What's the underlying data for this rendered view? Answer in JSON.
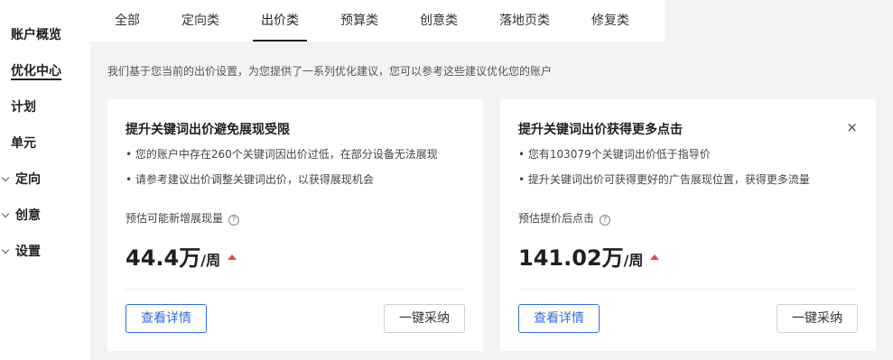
{
  "sidebar": {
    "items": [
      {
        "label": "账户概览"
      },
      {
        "label": "优化中心"
      },
      {
        "label": "计划"
      },
      {
        "label": "单元"
      },
      {
        "label": "定向"
      },
      {
        "label": "创意"
      },
      {
        "label": "设置"
      }
    ]
  },
  "tabs": [
    {
      "label": "全部"
    },
    {
      "label": "定向类"
    },
    {
      "label": "出价类"
    },
    {
      "label": "预算类"
    },
    {
      "label": "创意类"
    },
    {
      "label": "落地页类"
    },
    {
      "label": "修复类"
    }
  ],
  "intro_text": "我们基于您当前的出价设置，为您提供了一系列优化建议，您可以参考这些建议优化您的账户",
  "cards": [
    {
      "title": "提升关键词出价避免展现受限",
      "desc1": "• 您的账户中存在260个关键词因出价过低，在部分设备无法展现",
      "desc2": "• 请参考建议出价调整关键词出价，以获得展现机会",
      "metric_label": "预估可能新增展现量",
      "value": "44.4万",
      "unit": "/周",
      "detail_label": "查看详情",
      "adopt_label": "一键采纳"
    },
    {
      "title": "提升关键词出价获得更多点击",
      "desc1": "• 您有103079个关键词出价低于指导价",
      "desc2": "• 提升关键词出价可获得更好的广告展现位置，获得更多流量",
      "metric_label": "预估提价后点击",
      "value": "141.02万",
      "unit": "/周",
      "detail_label": "查看详情",
      "adopt_label": "一键采纳",
      "close_glyph": "×"
    }
  ],
  "help_glyph": "?",
  "colors": {
    "accent": "#2f6ddb",
    "trend_up": "#e5484d",
    "page_bg": "#f2f3f5"
  }
}
